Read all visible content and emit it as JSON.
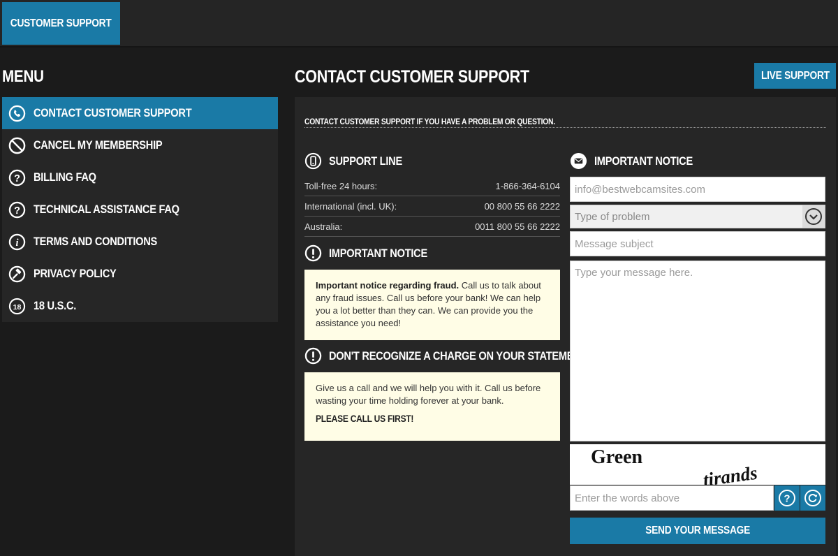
{
  "header": {
    "tab_label": "CUSTOMER SUPPORT"
  },
  "sidebar": {
    "title": "MENU",
    "items": [
      {
        "label": "CONTACT CUSTOMER SUPPORT",
        "icon": "phone-icon",
        "active": true
      },
      {
        "label": "CANCEL MY MEMBERSHIP",
        "icon": "prohibited-icon"
      },
      {
        "label": "BILLING FAQ",
        "icon": "question-icon"
      },
      {
        "label": "TECHNICAL ASSISTANCE FAQ",
        "icon": "question-icon"
      },
      {
        "label": "TERMS AND CONDITIONS",
        "icon": "info-icon"
      },
      {
        "label": "PRIVACY POLICY",
        "icon": "gavel-icon"
      },
      {
        "label": "18 U.S.C.",
        "icon": "eighteen-icon"
      }
    ]
  },
  "main": {
    "title": "CONTACT CUSTOMER SUPPORT",
    "live_support_label": "LIVE SUPPORT",
    "intro": "CONTACT CUSTOMER SUPPORT IF YOU HAVE A PROBLEM OR QUESTION.",
    "support_line": {
      "title": "SUPPORT LINE",
      "rows": [
        {
          "label": "Toll-free 24 hours:",
          "value": "1-866-364-6104"
        },
        {
          "label": "International (incl. UK):",
          "value": "00 800 55 66 2222"
        },
        {
          "label": "Australia:",
          "value": "0011 800 55 66 2222"
        }
      ]
    },
    "notice": {
      "title": "IMPORTANT NOTICE",
      "bold": "Important notice regarding fraud.",
      "text": " Call us to talk about any fraud issues. Call us before your bank! We can help you a lot better than they can. We can provide you the assistance you need!"
    },
    "charge": {
      "title": "DON'T RECOGNIZE A CHARGE ON YOUR STATEMENT?",
      "text": "Give us a call and we will help you with it. Call us before wasting your time holding forever at your bank.",
      "emphasis": "PLEASE CALL US FIRST!"
    },
    "form": {
      "title": "IMPORTANT NOTICE",
      "email_placeholder": "info@bestwebcamsites.com",
      "problem_placeholder": "Type of problem",
      "subject_placeholder": "Message subject",
      "message_placeholder": "Type your message here.",
      "captcha_word1": "Green",
      "captcha_word2": "tirands",
      "captcha_placeholder": "Enter the words above",
      "send_label": "SEND YOUR MESSAGE"
    }
  },
  "colors": {
    "accent": "#1a7aa6",
    "background": "#1b1b1b",
    "panel": "#262626",
    "notice_bg": "#fffde6"
  }
}
